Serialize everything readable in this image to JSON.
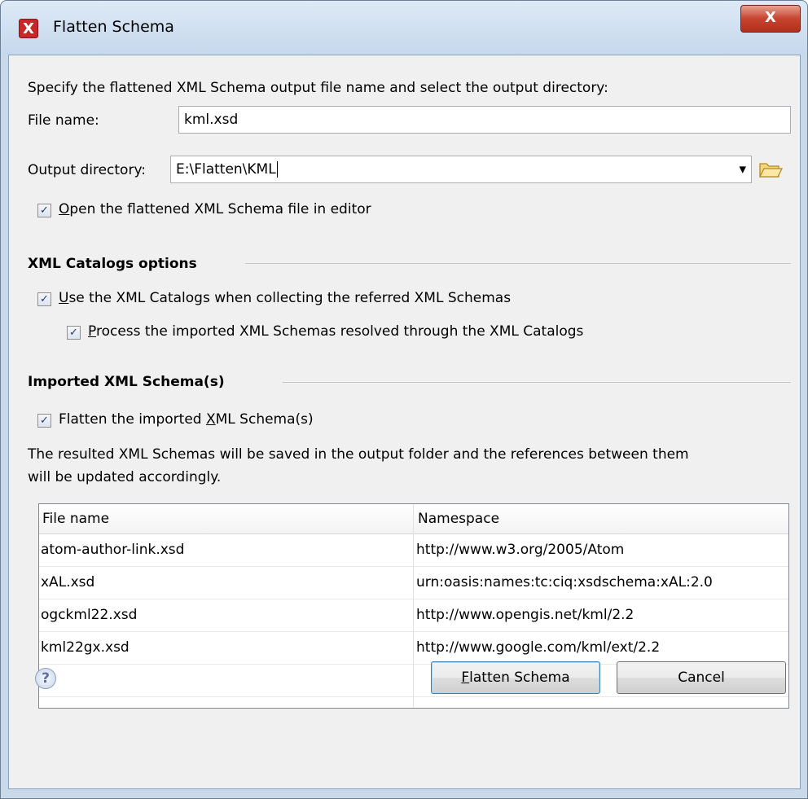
{
  "window": {
    "title": "Flatten Schema",
    "app_icon": "oxygen-x-icon",
    "close_glyph": "X"
  },
  "intro": "Specify the flattened XML Schema output file name and select the output directory:",
  "file_name": {
    "label": "File name:",
    "value": "kml.xsd"
  },
  "output_directory": {
    "label": "Output directory:",
    "value": "E:\\Flatten\\KML",
    "dropdown_glyph": "▾",
    "browse_icon": "folder-open-icon"
  },
  "open_in_editor": {
    "prefix": "",
    "mnemonic": "O",
    "rest": "pen the flattened XML Schema file in editor",
    "checked": true
  },
  "catalogs": {
    "title": "XML Catalogs options",
    "use_catalogs": {
      "mnemonic": "U",
      "rest": "se the XML Catalogs when collecting the referred XML Schemas",
      "checked": true
    },
    "process_imported": {
      "mnemonic": "P",
      "rest": "rocess the imported XML Schemas resolved through the XML Catalogs",
      "checked": true
    }
  },
  "imported": {
    "title": "Imported XML Schema(s)",
    "flatten_imported": {
      "prefix": "Flatten the imported ",
      "mnemonic": "X",
      "rest": "ML Schema(s)",
      "checked": true
    },
    "description_line1": "The resulted XML Schemas will be saved in the output folder and the references between them",
    "description_line2": "will be updated accordingly."
  },
  "table": {
    "columns": [
      "File name",
      "Namespace"
    ],
    "rows": [
      {
        "file": "atom-author-link.xsd",
        "namespace": "http://www.w3.org/2005/Atom"
      },
      {
        "file": "xAL.xsd",
        "namespace": "urn:oasis:names:tc:ciq:xsdschema:xAL:2.0"
      },
      {
        "file": "ogckml22.xsd",
        "namespace": "http://www.opengis.net/kml/2.2"
      },
      {
        "file": "kml22gx.xsd",
        "namespace": "http://www.google.com/kml/ext/2.2"
      }
    ]
  },
  "buttons": {
    "help_glyph": "?",
    "flatten_mnemonic": "F",
    "flatten_rest": "latten Schema",
    "cancel": "Cancel"
  },
  "check_glyph": "✓"
}
